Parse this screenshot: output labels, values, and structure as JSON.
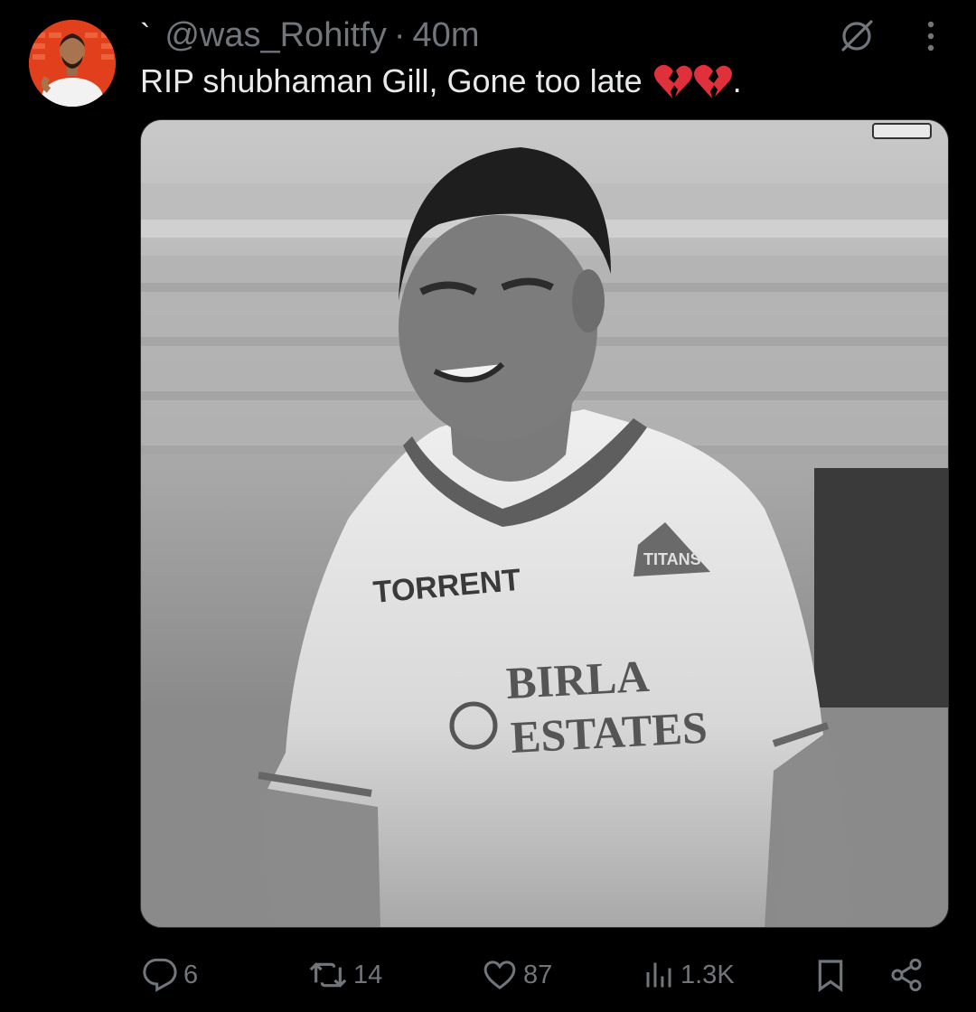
{
  "tweet": {
    "display_name": "`",
    "handle": "@was_Rohitfy",
    "separator": "·",
    "time": "40m",
    "text": "RIP shubhaman Gill, Gone too late",
    "text_suffix": ".",
    "media": {
      "jersey_sponsor": "TORRENT",
      "jersey_main_1": "BIRLA",
      "jersey_main_2": "ESTATES",
      "jersey_badge": "TITANS"
    },
    "actions": {
      "replies": "6",
      "reposts": "14",
      "likes": "87",
      "views": "1.3K"
    }
  },
  "icons": {
    "avatar": "avatar",
    "grok": "grok-icon",
    "more": "more-vertical-icon",
    "broken_heart": "broken-heart-emoji",
    "reply": "reply-icon",
    "repost": "repost-icon",
    "like": "heart-icon",
    "views": "views-icon",
    "bookmark": "bookmark-icon",
    "share": "share-icon"
  },
  "colors": {
    "background": "#000000",
    "text_primary": "#e7e9ea",
    "text_secondary": "#71767b",
    "avatar_bg": "#e2401c",
    "emoji_red": "#e0303c"
  }
}
